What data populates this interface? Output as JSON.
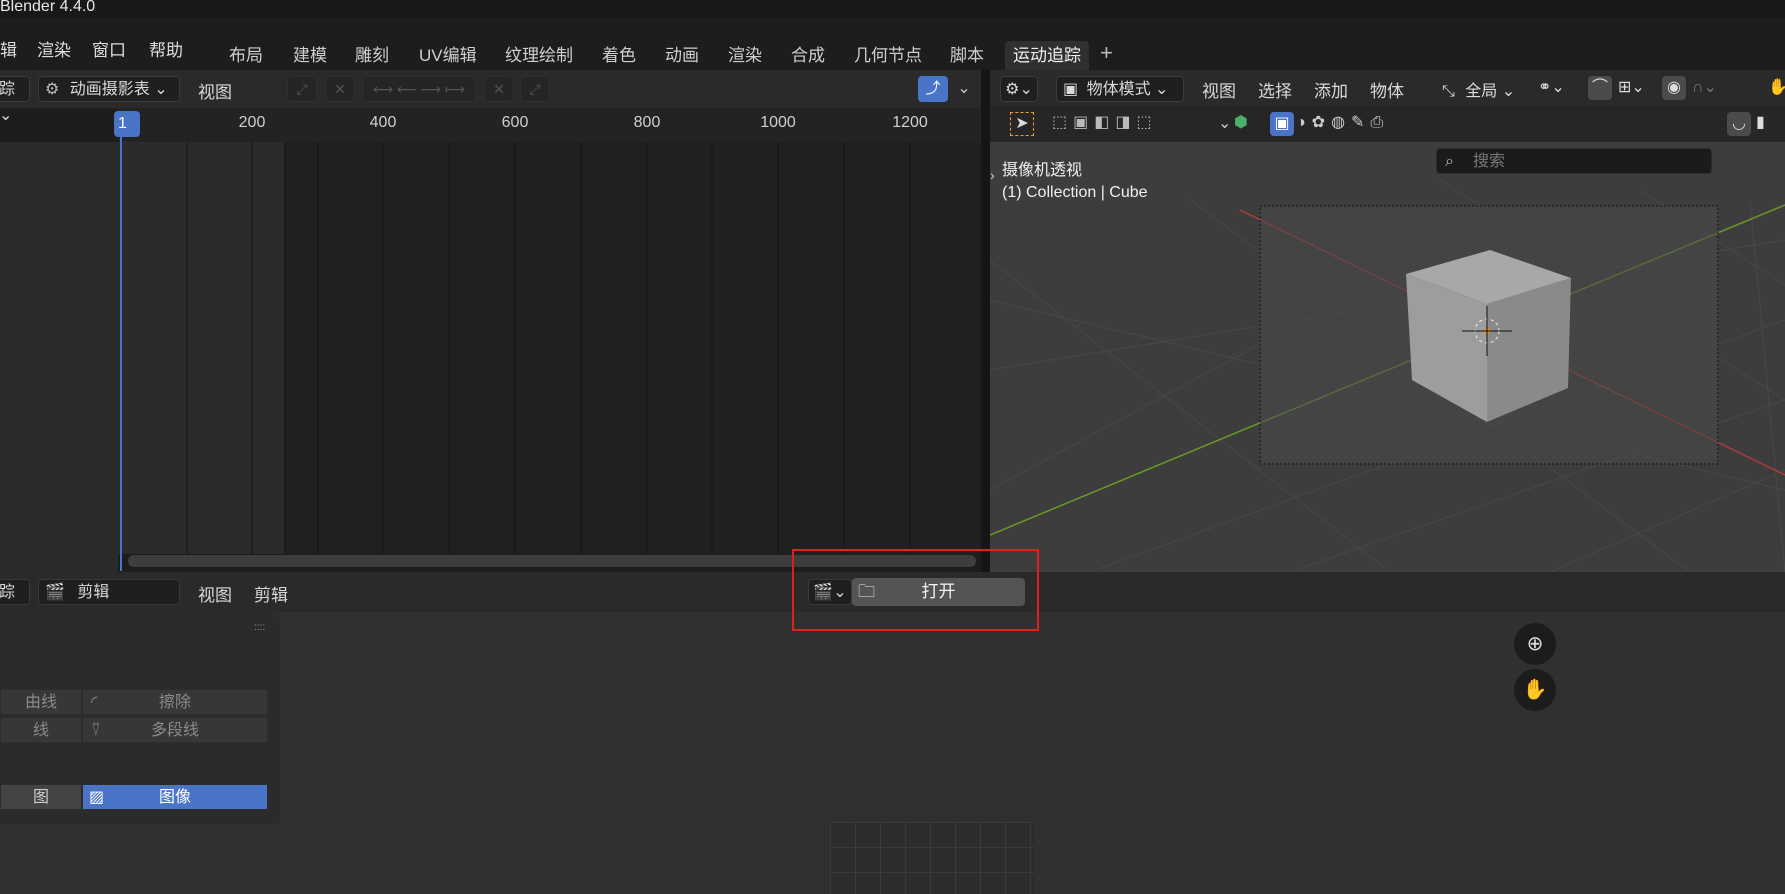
{
  "app": {
    "title": "Blender 4.4.0"
  },
  "menu": {
    "items": [
      "辑",
      "渲染",
      "窗口",
      "帮助"
    ]
  },
  "workspaces": {
    "tabs": [
      "布局",
      "建模",
      "雕刻",
      "UV编辑",
      "纹理绘制",
      "着色",
      "动画",
      "渲染",
      "合成",
      "几何节点",
      "脚本",
      "运动追踪"
    ],
    "active": "运动追踪",
    "add_symbol": "+"
  },
  "dopesheet": {
    "editor_type_fragment": "踪",
    "mode_label": "动画摄影表",
    "view_menu": "视图",
    "current_frame": "1",
    "ruler_ticks": [
      "200",
      "400",
      "600",
      "800",
      "1000",
      "1200"
    ]
  },
  "viewport": {
    "mode_label": "物体模式",
    "menus": [
      "视图",
      "选择",
      "添加",
      "物体"
    ],
    "transform_orientation": "全局",
    "search_placeholder": "搜索",
    "overlay_title": "摄像机透视",
    "overlay_subtitle": "(1) Collection | Cube"
  },
  "clip_editor": {
    "editor_type_fragment": "踪",
    "mode_label": "剪辑",
    "menus": [
      "视图",
      "剪辑"
    ],
    "open_label": "打开",
    "panel": {
      "row1_left": "由线",
      "row1_right": "擦除",
      "row2_left": "线",
      "row2_right": "多段线",
      "row3_left": "图",
      "row3_right": "图像"
    }
  },
  "colors": {
    "accent": "#4a75c6",
    "highlight": "#e0201b",
    "x_axis": "#b03a3a",
    "y_axis": "#6b9a2a"
  }
}
